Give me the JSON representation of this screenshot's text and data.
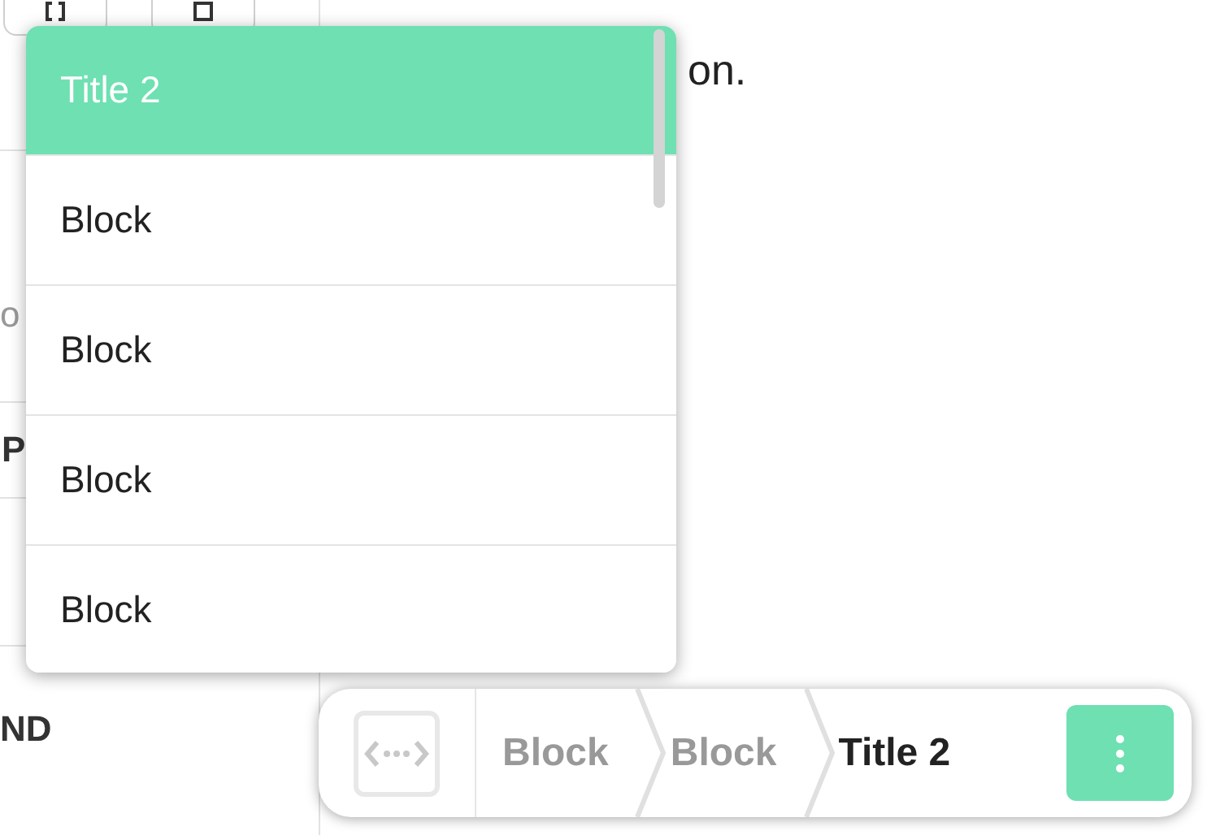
{
  "sidebar": {
    "sections": [
      {
        "text": "o",
        "kind": "muted"
      },
      {
        "text": "P",
        "kind": "heading"
      },
      {
        "kind": "empty"
      },
      {
        "text": "ND",
        "kind": "heading"
      }
    ]
  },
  "content": {
    "text": "on."
  },
  "dropdown": {
    "items": [
      {
        "label": "Title 2",
        "selected": true
      },
      {
        "label": "Block",
        "selected": false
      },
      {
        "label": "Block",
        "selected": false
      },
      {
        "label": "Block",
        "selected": false
      },
      {
        "label": "Block",
        "selected": false
      }
    ]
  },
  "breadcrumb": {
    "items": [
      {
        "label": "Block",
        "current": false
      },
      {
        "label": "Block",
        "current": false
      },
      {
        "label": "Title 2",
        "current": true
      }
    ]
  }
}
